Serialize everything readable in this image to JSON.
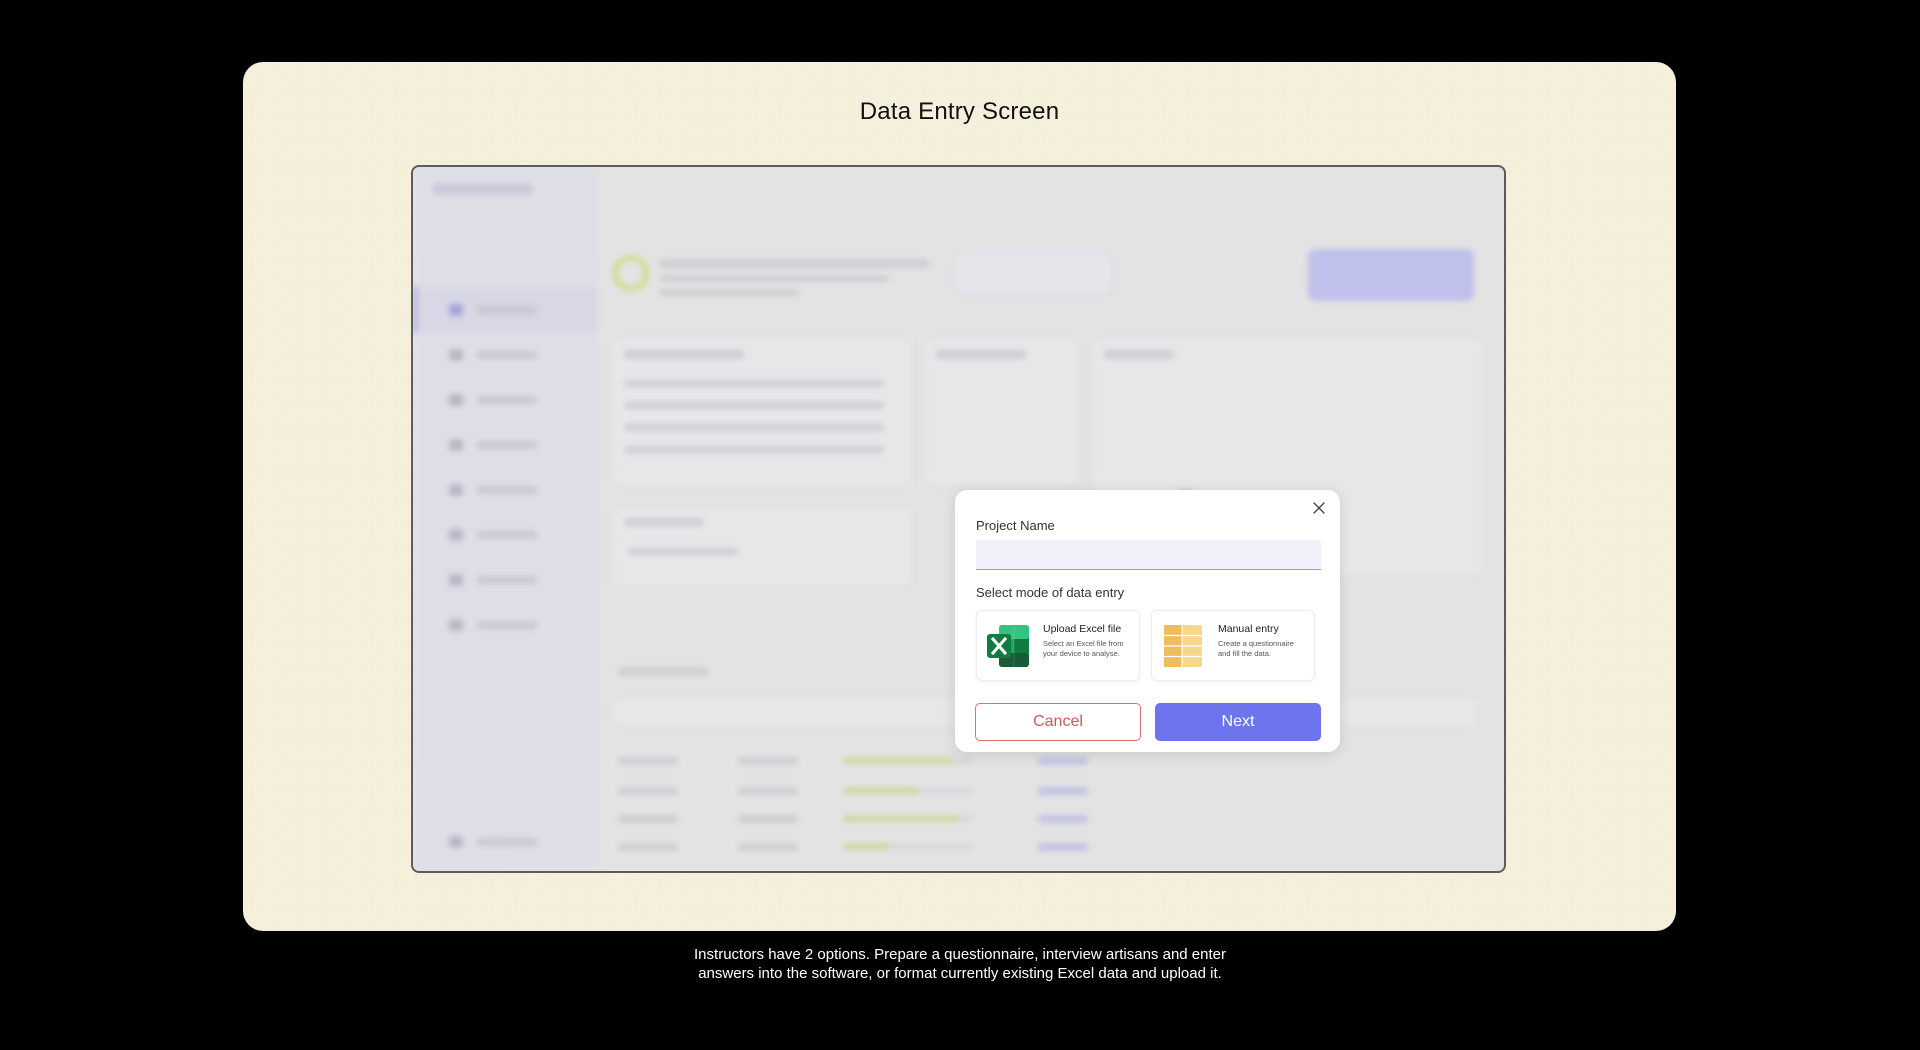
{
  "card": {
    "title": "Data Entry Screen"
  },
  "modal": {
    "project_name_label": "Project Name",
    "project_name_value": "",
    "mode_label": "Select mode of data entry",
    "options": [
      {
        "title": "Upload Excel file",
        "description": "Select an Excel file from your device to analyse.",
        "icon": "excel-icon"
      },
      {
        "title": "Manual entry",
        "description": "Create a questionnaire and fill the data.",
        "icon": "table-sheet-icon"
      }
    ],
    "cancel_label": "Cancel",
    "next_label": "Next",
    "close_icon": "close-icon"
  },
  "caption": {
    "line1": "Instructors have 2 options. Prepare a questionnaire, interview artisans and enter",
    "line2": "answers into the software, or format currently existing Excel data and upload it."
  },
  "colors": {
    "accent": "#6e74ee",
    "cancel": "#e06e6e",
    "card_bg": "#f5f0dc",
    "excel_green": "#1f7a45",
    "manual_yellow": "#f2c36b"
  }
}
